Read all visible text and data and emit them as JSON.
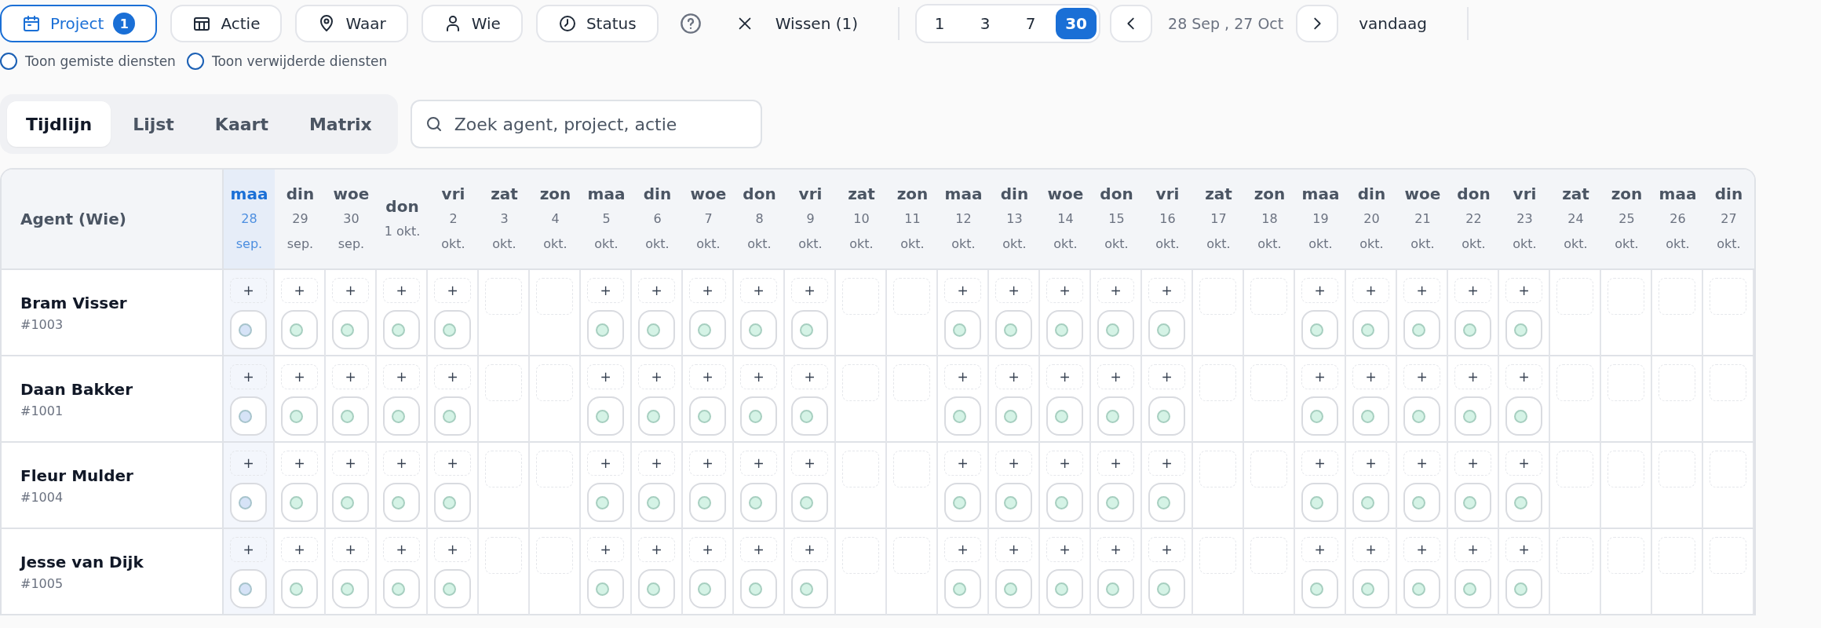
{
  "filters": [
    {
      "kind": "project",
      "label": "Project",
      "active": true,
      "badge": "1"
    },
    {
      "kind": "action",
      "label": "Actie",
      "active": false
    },
    {
      "kind": "place",
      "label": "Waar",
      "active": false
    },
    {
      "kind": "person",
      "label": "Wie",
      "active": false
    },
    {
      "kind": "status",
      "label": "Status",
      "active": false
    }
  ],
  "clear": {
    "label": "Wissen (1)"
  },
  "ranges": [
    {
      "label": "1",
      "selected": false
    },
    {
      "label": "3",
      "selected": false
    },
    {
      "label": "7",
      "selected": false
    },
    {
      "label": "30",
      "selected": true
    }
  ],
  "period": {
    "label": "28 Sep , 27 Oct"
  },
  "today_button": {
    "label": "vandaag"
  },
  "options": [
    {
      "label": "Toon gemiste diensten",
      "checked": false
    },
    {
      "label": "Toon verwijderde diensten",
      "checked": false
    }
  ],
  "views": [
    {
      "label": "Tijdlijn",
      "selected": true
    },
    {
      "label": "Lijst",
      "selected": false
    },
    {
      "label": "Kaart",
      "selected": false
    },
    {
      "label": "Matrix",
      "selected": false
    }
  ],
  "search": {
    "placeholder": "Zoek agent, project, actie"
  },
  "table": {
    "agent_header": "Agent (Wie)",
    "days": [
      {
        "weekday": "maa",
        "day": "28",
        "month": "sep.",
        "selected": true
      },
      {
        "weekday": "din",
        "day": "29",
        "month": "sep.",
        "selected": false
      },
      {
        "weekday": "woe",
        "day": "30",
        "month": "sep.",
        "selected": false
      },
      {
        "weekday": "don",
        "date": "1 okt.",
        "selected": false
      },
      {
        "weekday": "vri",
        "day": "2",
        "month": "okt.",
        "selected": false
      },
      {
        "weekday": "zat",
        "day": "3",
        "month": "okt.",
        "selected": false
      },
      {
        "weekday": "zon",
        "day": "4",
        "month": "okt.",
        "selected": false
      },
      {
        "weekday": "maa",
        "day": "5",
        "month": "okt.",
        "selected": false
      },
      {
        "weekday": "din",
        "day": "6",
        "month": "okt.",
        "selected": false
      },
      {
        "weekday": "woe",
        "day": "7",
        "month": "okt.",
        "selected": false
      },
      {
        "weekday": "don",
        "day": "8",
        "month": "okt.",
        "selected": false
      },
      {
        "weekday": "vri",
        "day": "9",
        "month": "okt.",
        "selected": false
      },
      {
        "weekday": "zat",
        "day": "10",
        "month": "okt.",
        "selected": false
      },
      {
        "weekday": "zon",
        "day": "11",
        "month": "okt.",
        "selected": false
      },
      {
        "weekday": "maa",
        "day": "12",
        "month": "okt.",
        "selected": false
      },
      {
        "weekday": "din",
        "day": "13",
        "month": "okt.",
        "selected": false
      },
      {
        "weekday": "woe",
        "day": "14",
        "month": "okt.",
        "selected": false
      },
      {
        "weekday": "don",
        "day": "15",
        "month": "okt.",
        "selected": false
      },
      {
        "weekday": "vri",
        "day": "16",
        "month": "okt.",
        "selected": false
      },
      {
        "weekday": "zat",
        "day": "17",
        "month": "okt.",
        "selected": false
      },
      {
        "weekday": "zon",
        "day": "18",
        "month": "okt.",
        "selected": false
      },
      {
        "weekday": "maa",
        "day": "19",
        "month": "okt.",
        "selected": false
      },
      {
        "weekday": "din",
        "day": "20",
        "month": "okt.",
        "selected": false
      },
      {
        "weekday": "woe",
        "day": "21",
        "month": "okt.",
        "selected": false
      },
      {
        "weekday": "don",
        "day": "22",
        "month": "okt.",
        "selected": false
      },
      {
        "weekday": "vri",
        "day": "23",
        "month": "okt.",
        "selected": false
      },
      {
        "weekday": "zat",
        "day": "24",
        "month": "okt.",
        "selected": false
      },
      {
        "weekday": "zon",
        "day": "25",
        "month": "okt.",
        "selected": false
      },
      {
        "weekday": "maa",
        "day": "26",
        "month": "okt.",
        "selected": false
      },
      {
        "weekday": "din",
        "day": "27",
        "month": "okt.",
        "selected": false
      }
    ],
    "agents": [
      {
        "name": "Bram Visser",
        "number": "#1003",
        "cells": [
          {
            "kind": "shift",
            "add": "+",
            "color": "#d6e3f7"
          },
          {
            "kind": "shift",
            "add": "+",
            "color": "#d5f3e6"
          },
          {
            "kind": "shift",
            "add": "+",
            "color": "#d5f3e6"
          },
          {
            "kind": "shift",
            "add": "+",
            "color": "#d5f3e6"
          },
          {
            "kind": "shift",
            "add": "+",
            "color": "#d5f3e6"
          },
          {
            "kind": "free"
          },
          {
            "kind": "free"
          },
          {
            "kind": "shift",
            "add": "+",
            "color": "#d5f3e6"
          },
          {
            "kind": "shift",
            "add": "+",
            "color": "#d5f3e6"
          },
          {
            "kind": "shift",
            "add": "+",
            "color": "#d5f3e6"
          },
          {
            "kind": "shift",
            "add": "+",
            "color": "#d5f3e6"
          },
          {
            "kind": "shift",
            "add": "+",
            "color": "#d5f3e6"
          },
          {
            "kind": "free"
          },
          {
            "kind": "free"
          },
          {
            "kind": "shift",
            "add": "+",
            "color": "#d5f3e6"
          },
          {
            "kind": "shift",
            "add": "+",
            "color": "#d5f3e6"
          },
          {
            "kind": "shift",
            "add": "+",
            "color": "#d5f3e6"
          },
          {
            "kind": "shift",
            "add": "+",
            "color": "#d5f3e6"
          },
          {
            "kind": "shift",
            "add": "+",
            "color": "#d5f3e6"
          },
          {
            "kind": "free"
          },
          {
            "kind": "free"
          },
          {
            "kind": "shift",
            "add": "+",
            "color": "#d5f3e6"
          },
          {
            "kind": "shift",
            "add": "+",
            "color": "#d5f3e6"
          },
          {
            "kind": "shift",
            "add": "+",
            "color": "#d5f3e6"
          },
          {
            "kind": "shift",
            "add": "+",
            "color": "#d5f3e6"
          },
          {
            "kind": "shift",
            "add": "+",
            "color": "#d5f3e6"
          },
          {
            "kind": "free"
          },
          {
            "kind": "free"
          },
          {
            "kind": "free"
          },
          {
            "kind": "free"
          }
        ]
      },
      {
        "name": "Daan Bakker",
        "number": "#1001",
        "cells": [
          {
            "kind": "shift",
            "add": "+",
            "color": "#d6e3f7"
          },
          {
            "kind": "shift",
            "add": "+",
            "color": "#d5f3e6"
          },
          {
            "kind": "shift",
            "add": "+",
            "color": "#d5f3e6"
          },
          {
            "kind": "shift",
            "add": "+",
            "color": "#d5f3e6"
          },
          {
            "kind": "shift",
            "add": "+",
            "color": "#d5f3e6"
          },
          {
            "kind": "free"
          },
          {
            "kind": "free"
          },
          {
            "kind": "shift",
            "add": "+",
            "color": "#d5f3e6"
          },
          {
            "kind": "shift",
            "add": "+",
            "color": "#d5f3e6"
          },
          {
            "kind": "shift",
            "add": "+",
            "color": "#d5f3e6"
          },
          {
            "kind": "shift",
            "add": "+",
            "color": "#d5f3e6"
          },
          {
            "kind": "shift",
            "add": "+",
            "color": "#d5f3e6"
          },
          {
            "kind": "free"
          },
          {
            "kind": "free"
          },
          {
            "kind": "shift",
            "add": "+",
            "color": "#d5f3e6"
          },
          {
            "kind": "shift",
            "add": "+",
            "color": "#d5f3e6"
          },
          {
            "kind": "shift",
            "add": "+",
            "color": "#d5f3e6"
          },
          {
            "kind": "shift",
            "add": "+",
            "color": "#d5f3e6"
          },
          {
            "kind": "shift",
            "add": "+",
            "color": "#d5f3e6"
          },
          {
            "kind": "free"
          },
          {
            "kind": "free"
          },
          {
            "kind": "shift",
            "add": "+",
            "color": "#d5f3e6"
          },
          {
            "kind": "shift",
            "add": "+",
            "color": "#d5f3e6"
          },
          {
            "kind": "shift",
            "add": "+",
            "color": "#d5f3e6"
          },
          {
            "kind": "shift",
            "add": "+",
            "color": "#d5f3e6"
          },
          {
            "kind": "shift",
            "add": "+",
            "color": "#d5f3e6"
          },
          {
            "kind": "free"
          },
          {
            "kind": "free"
          },
          {
            "kind": "free"
          },
          {
            "kind": "free"
          }
        ]
      },
      {
        "name": "Fleur Mulder",
        "number": "#1004",
        "cells": [
          {
            "kind": "shift",
            "add": "+",
            "color": "#d6e3f7"
          },
          {
            "kind": "shift",
            "add": "+",
            "color": "#d5f3e6"
          },
          {
            "kind": "shift",
            "add": "+",
            "color": "#d5f3e6"
          },
          {
            "kind": "shift",
            "add": "+",
            "color": "#d5f3e6"
          },
          {
            "kind": "shift",
            "add": "+",
            "color": "#d5f3e6"
          },
          {
            "kind": "free"
          },
          {
            "kind": "free"
          },
          {
            "kind": "shift",
            "add": "+",
            "color": "#d5f3e6"
          },
          {
            "kind": "shift",
            "add": "+",
            "color": "#d5f3e6"
          },
          {
            "kind": "shift",
            "add": "+",
            "color": "#d5f3e6"
          },
          {
            "kind": "shift",
            "add": "+",
            "color": "#d5f3e6"
          },
          {
            "kind": "shift",
            "add": "+",
            "color": "#d5f3e6"
          },
          {
            "kind": "free"
          },
          {
            "kind": "free"
          },
          {
            "kind": "shift",
            "add": "+",
            "color": "#d5f3e6"
          },
          {
            "kind": "shift",
            "add": "+",
            "color": "#d5f3e6"
          },
          {
            "kind": "shift",
            "add": "+",
            "color": "#d5f3e6"
          },
          {
            "kind": "shift",
            "add": "+",
            "color": "#d5f3e6"
          },
          {
            "kind": "shift",
            "add": "+",
            "color": "#d5f3e6"
          },
          {
            "kind": "free"
          },
          {
            "kind": "free"
          },
          {
            "kind": "shift",
            "add": "+",
            "color": "#d5f3e6"
          },
          {
            "kind": "shift",
            "add": "+",
            "color": "#d5f3e6"
          },
          {
            "kind": "shift",
            "add": "+",
            "color": "#d5f3e6"
          },
          {
            "kind": "shift",
            "add": "+",
            "color": "#d5f3e6"
          },
          {
            "kind": "shift",
            "add": "+",
            "color": "#d5f3e6"
          },
          {
            "kind": "free"
          },
          {
            "kind": "free"
          },
          {
            "kind": "free"
          },
          {
            "kind": "free"
          }
        ]
      },
      {
        "name": "Jesse van Dijk",
        "number": "#1005",
        "cells": [
          {
            "kind": "shift",
            "add": "+",
            "color": "#d6e3f7"
          },
          {
            "kind": "shift",
            "add": "+",
            "color": "#d5f3e6"
          },
          {
            "kind": "shift",
            "add": "+",
            "color": "#d5f3e6"
          },
          {
            "kind": "shift",
            "add": "+",
            "color": "#d5f3e6"
          },
          {
            "kind": "shift",
            "add": "+",
            "color": "#d5f3e6"
          },
          {
            "kind": "free"
          },
          {
            "kind": "free"
          },
          {
            "kind": "shift",
            "add": "+",
            "color": "#d5f3e6"
          },
          {
            "kind": "shift",
            "add": "+",
            "color": "#d5f3e6"
          },
          {
            "kind": "shift",
            "add": "+",
            "color": "#d5f3e6"
          },
          {
            "kind": "shift",
            "add": "+",
            "color": "#d5f3e6"
          },
          {
            "kind": "shift",
            "add": "+",
            "color": "#d5f3e6"
          },
          {
            "kind": "free"
          },
          {
            "kind": "free"
          },
          {
            "kind": "shift",
            "add": "+",
            "color": "#d5f3e6"
          },
          {
            "kind": "shift",
            "add": "+",
            "color": "#d5f3e6"
          },
          {
            "kind": "shift",
            "add": "+",
            "color": "#d5f3e6"
          },
          {
            "kind": "shift",
            "add": "+",
            "color": "#d5f3e6"
          },
          {
            "kind": "shift",
            "add": "+",
            "color": "#d5f3e6"
          },
          {
            "kind": "free"
          },
          {
            "kind": "free"
          },
          {
            "kind": "shift",
            "add": "+",
            "color": "#d5f3e6"
          },
          {
            "kind": "shift",
            "add": "+",
            "color": "#d5f3e6"
          },
          {
            "kind": "shift",
            "add": "+",
            "color": "#d5f3e6"
          },
          {
            "kind": "shift",
            "add": "+",
            "color": "#d5f3e6"
          },
          {
            "kind": "shift",
            "add": "+",
            "color": "#d5f3e6"
          },
          {
            "kind": "free"
          },
          {
            "kind": "free"
          },
          {
            "kind": "free"
          },
          {
            "kind": "free"
          }
        ]
      }
    ]
  }
}
